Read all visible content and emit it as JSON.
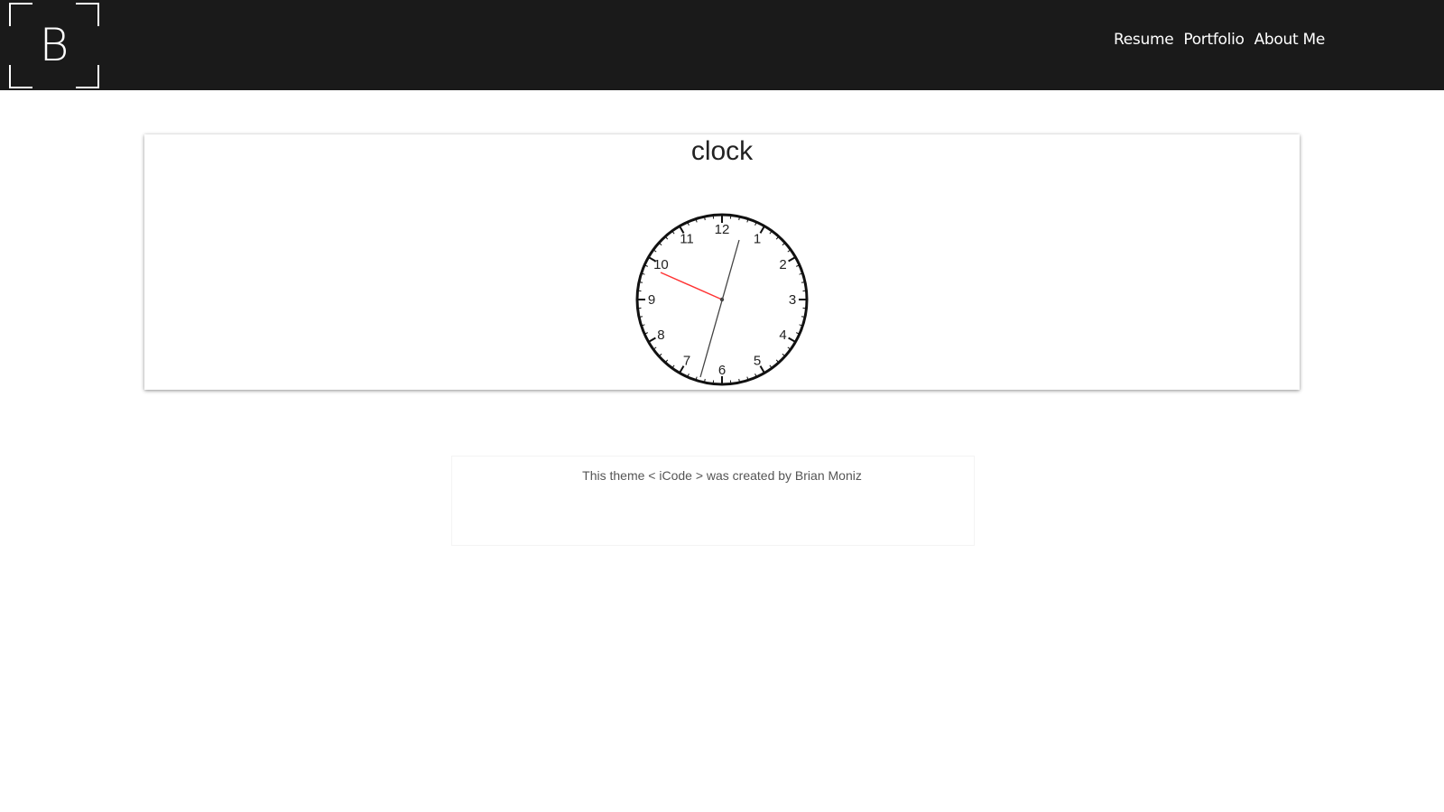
{
  "header": {
    "logo_letter": "B",
    "nav": [
      {
        "label": "Resume"
      },
      {
        "label": "Portfolio"
      },
      {
        "label": "About Me"
      }
    ]
  },
  "main": {
    "title": "clock",
    "clock": {
      "numerals": [
        "12",
        "1",
        "2",
        "3",
        "4",
        "5",
        "6",
        "7",
        "8",
        "9",
        "10",
        "11"
      ],
      "hour_hand_color": "#ff3333",
      "minute_hand_color": "#444444",
      "face_color": "#ffffff",
      "rim_color": "#111111"
    }
  },
  "footer": {
    "credit": "This theme < iCode > was created by Brian Moniz"
  },
  "colors": {
    "header_bg": "#1a1a1a",
    "page_bg": "#ffffff"
  }
}
